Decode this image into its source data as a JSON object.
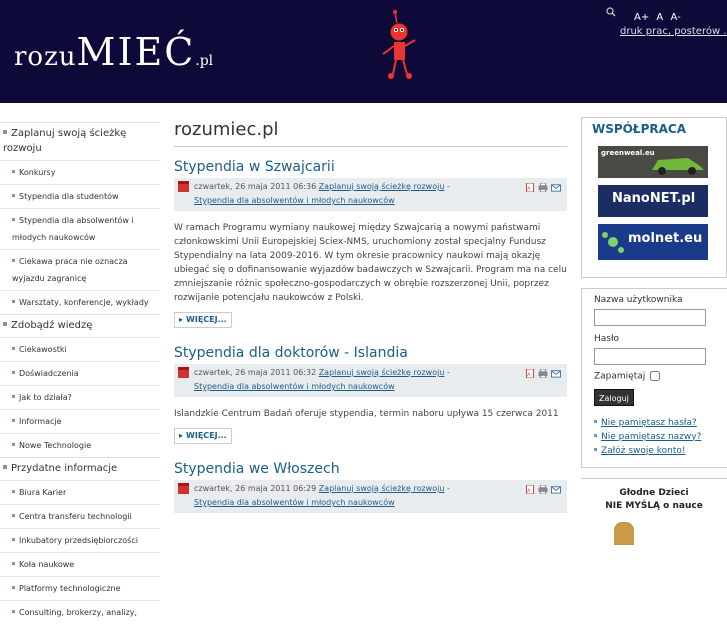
{
  "header": {
    "logo": {
      "part1": "rozu",
      "part2": "MIEĆ",
      "part3": ".pl"
    },
    "font_sizes": [
      "A+",
      "A",
      "A-"
    ],
    "tagline": "druk prac, posterów ..."
  },
  "left_nav": [
    {
      "label": "Zaplanuj swoją ścieżkę rozwoju",
      "level": 1
    },
    {
      "label": "Konkursy",
      "level": 2
    },
    {
      "label": "Stypendia dla studentów",
      "level": 2
    },
    {
      "label": "Stypendia dla absolwentów i młodych naukowców",
      "level": 2
    },
    {
      "label": "Ciekawa praca nie oznacza wyjazdu zagranicę",
      "level": 2
    },
    {
      "label": "Warsztaty, konferencje, wykłady",
      "level": 2
    },
    {
      "label": "Zdobądź wiedzę",
      "level": 1
    },
    {
      "label": "Ciekawostki",
      "level": 2
    },
    {
      "label": "Doświadczenia",
      "level": 2
    },
    {
      "label": "Jak to działa?",
      "level": 2
    },
    {
      "label": "Informacje",
      "level": 2
    },
    {
      "label": "Nowe Technologie",
      "level": 2
    },
    {
      "label": "Przydatne informacje",
      "level": 1
    },
    {
      "label": "Biura Karier",
      "level": 2
    },
    {
      "label": "Centra transferu technologii",
      "level": 2
    },
    {
      "label": "Inkubatory przedsiębiorczości",
      "level": 2
    },
    {
      "label": "Koła naukowe",
      "level": 2
    },
    {
      "label": "Platformy technologiczne",
      "level": 2
    },
    {
      "label": "Consulting, brokerzy, analizy,",
      "level": 2
    }
  ],
  "main": {
    "page_title": "rozumiec.pl",
    "articles": [
      {
        "title": "Stypendia w Szwajcarii",
        "date": "czwartek, 26 maja 2011 06:36",
        "cat1": "Zaplanuj swoją ścieżkę rozwoju",
        "cat2": "Stypendia dla absolwentów i młodych naukowców",
        "body": "W ramach Programu wymiany naukowej między Szwajcarią a nowymi państwami członkowskimi Unii Europejskiej Sciex-NMS, uruchomiony został specjalny Fundusz Stypendialny na lata 2009-2016. W tym okresie pracownicy naukowi mają okazję ubiegać się o dofinansowanie wyjazdów badawczych w Szwajcarii. Program ma na celu zmniejszanie różnic społeczno-gospodarczych w obrębie rozszerzonej Unii, poprzez rozwijanie potencjału naukowców z Polski.",
        "more": "WIĘCEJ..."
      },
      {
        "title": "Stypendia dla doktorów - Islandia",
        "date": "czwartek, 26 maja 2011 06:32",
        "cat1": "Zaplanuj swoją ścieżkę rozwoju",
        "cat2": "Stypendia dla absolwentów i młodych naukowców",
        "body": "Islandzkie Centrum Badań oferuje stypendia, termin naboru upływa 15 czerwca 2011",
        "more": "WIĘCEJ..."
      },
      {
        "title": "Stypendia we Włoszech",
        "date": "czwartek, 26 maja 2011 06:29",
        "cat1": "Zaplanuj swoją ścieżkę rozwoju",
        "cat2": "Stypendia dla absolwentów i młodych naukowców"
      }
    ]
  },
  "right": {
    "coop_title": "WSPÓŁPRACA",
    "banners": [
      "greenweal.eu",
      "NanoNET.pl",
      "molnet.eu"
    ],
    "login": {
      "username_label": "Nazwa użytkownika",
      "password_label": "Hasło",
      "remember_label": "Zapamiętaj",
      "button": "Zaloguj",
      "links": [
        "Nie pamiętasz hasła?",
        "Nie pamiętasz nazwy?",
        "Załóż swoje konto!"
      ]
    },
    "hungry_line1": "Głodne Dzieci",
    "hungry_line2": "NIE MYŚLĄ o nauce"
  },
  "colors": {
    "header_bg": "#0d0a3a",
    "link": "#1a5e8a",
    "meta_bg": "#e9ecef"
  }
}
